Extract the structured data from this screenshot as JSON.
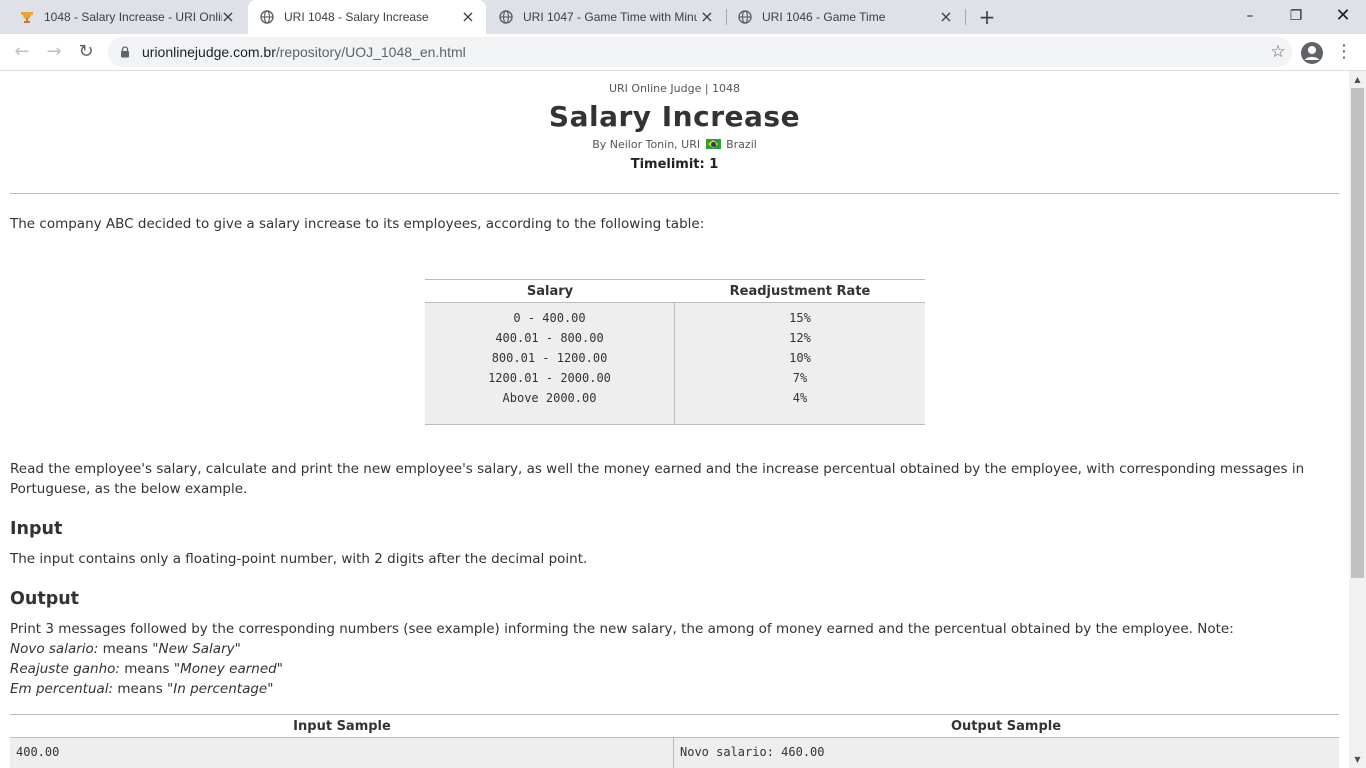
{
  "browser": {
    "tabs": [
      {
        "title": "1048 - Salary Increase - URI Online Judge",
        "favicon": "uri-trophy-icon"
      },
      {
        "title": "URI 1048 - Salary Increase",
        "favicon": "globe-icon"
      },
      {
        "title": "URI 1047 - Game Time with Minutes",
        "favicon": "globe-icon"
      },
      {
        "title": "URI 1046 - Game Time",
        "favicon": "globe-icon"
      }
    ],
    "active_tab": 1,
    "url_domain": "urionlinejudge.com.br",
    "url_path": "/repository/UOJ_1048_en.html"
  },
  "problem": {
    "judge_line": "URI Online Judge | 1048",
    "title": "Salary Increase",
    "author_prefix": "By Neilor Tonin, URI",
    "country": "Brazil",
    "timelimit": "Timelimit: 1",
    "intro": "The company ABC decided to give a salary increase to its employees, according to the following table:",
    "table": {
      "headers": [
        "Salary",
        "Readjustment Rate"
      ],
      "rows": [
        [
          "0 - 400.00",
          "15%"
        ],
        [
          "400.01 - 800.00",
          "12%"
        ],
        [
          "800.01 - 1200.00",
          "10%"
        ],
        [
          "1200.01 - 2000.00",
          "7%"
        ],
        [
          "Above 2000.00",
          "4%"
        ]
      ]
    },
    "description": "Read the employee's salary, calculate and print the new employee's salary, as well the money earned and the increase percentual obtained by the employee, with corresponding messages in Portuguese, as the below example.",
    "input_heading": "Input",
    "input_text": "The input contains only a floating-point number, with 2 digits after the decimal point.",
    "output_heading": "Output",
    "output_text": "Print 3 messages followed by the corresponding numbers (see example) informing the new salary, the among of money earned and the percentual obtained by the employee. Note:",
    "notes": [
      {
        "term": "Novo salario:",
        "means": "means",
        "meaning": "\"New Salary\""
      },
      {
        "term": "Reajuste ganho:",
        "means": "means",
        "meaning": "\"Money earned\""
      },
      {
        "term": "Em percentual:",
        "means": "means",
        "meaning": "\"In percentage\""
      }
    ],
    "sample": {
      "input_header": "Input Sample",
      "output_header": "Output Sample",
      "input_value": "400.00",
      "output_value": "Novo salario: 460.00"
    }
  },
  "colors": {
    "tabstrip": "#dee1e6",
    "table_body": "#eeeeee",
    "flag_green": "#2e9e3c",
    "flag_yellow": "#f6d400",
    "flag_blue": "#1f3b8c"
  }
}
